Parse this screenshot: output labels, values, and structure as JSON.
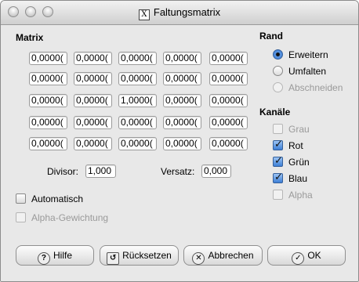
{
  "window": {
    "title": "Faltungsmatrix",
    "icon": "x-app-icon"
  },
  "matrix": {
    "label": "Matrix",
    "rows": [
      [
        "0,0000(",
        "0,0000(",
        "0,0000(",
        "0,0000(",
        "0,0000("
      ],
      [
        "0,0000(",
        "0,0000(",
        "0,0000(",
        "0,0000(",
        "0,0000("
      ],
      [
        "0,0000(",
        "0,0000(",
        "1,0000(",
        "0,0000(",
        "0,0000("
      ],
      [
        "0,0000(",
        "0,0000(",
        "0,0000(",
        "0,0000(",
        "0,0000("
      ],
      [
        "0,0000(",
        "0,0000(",
        "0,0000(",
        "0,0000(",
        "0,0000("
      ]
    ]
  },
  "divisor": {
    "label": "Divisor:",
    "value": "1,000"
  },
  "offset": {
    "label": "Versatz:",
    "value": "0,000"
  },
  "options": {
    "automatic": {
      "label": "Automatisch",
      "checked": false,
      "enabled": true
    },
    "alpha_weighting": {
      "label": "Alpha-Gewichtung",
      "checked": false,
      "enabled": false
    }
  },
  "border": {
    "label": "Rand",
    "options": [
      {
        "label": "Erweitern",
        "selected": true,
        "enabled": true
      },
      {
        "label": "Umfalten",
        "selected": false,
        "enabled": true
      },
      {
        "label": "Abschneiden",
        "selected": false,
        "enabled": false
      }
    ]
  },
  "channels": {
    "label": "Kanäle",
    "items": [
      {
        "label": "Grau",
        "checked": false,
        "enabled": false
      },
      {
        "label": "Rot",
        "checked": true,
        "enabled": true
      },
      {
        "label": "Grün",
        "checked": true,
        "enabled": true
      },
      {
        "label": "Blau",
        "checked": true,
        "enabled": true
      },
      {
        "label": "Alpha",
        "checked": false,
        "enabled": false
      }
    ]
  },
  "buttons": {
    "help": {
      "label": "Hilfe",
      "icon": "help-icon"
    },
    "reset": {
      "label": "Rücksetzen",
      "icon": "reset-icon"
    },
    "cancel": {
      "label": "Abbrechen",
      "icon": "cancel-icon"
    },
    "ok": {
      "label": "OK",
      "icon": "ok-check-icon"
    }
  }
}
